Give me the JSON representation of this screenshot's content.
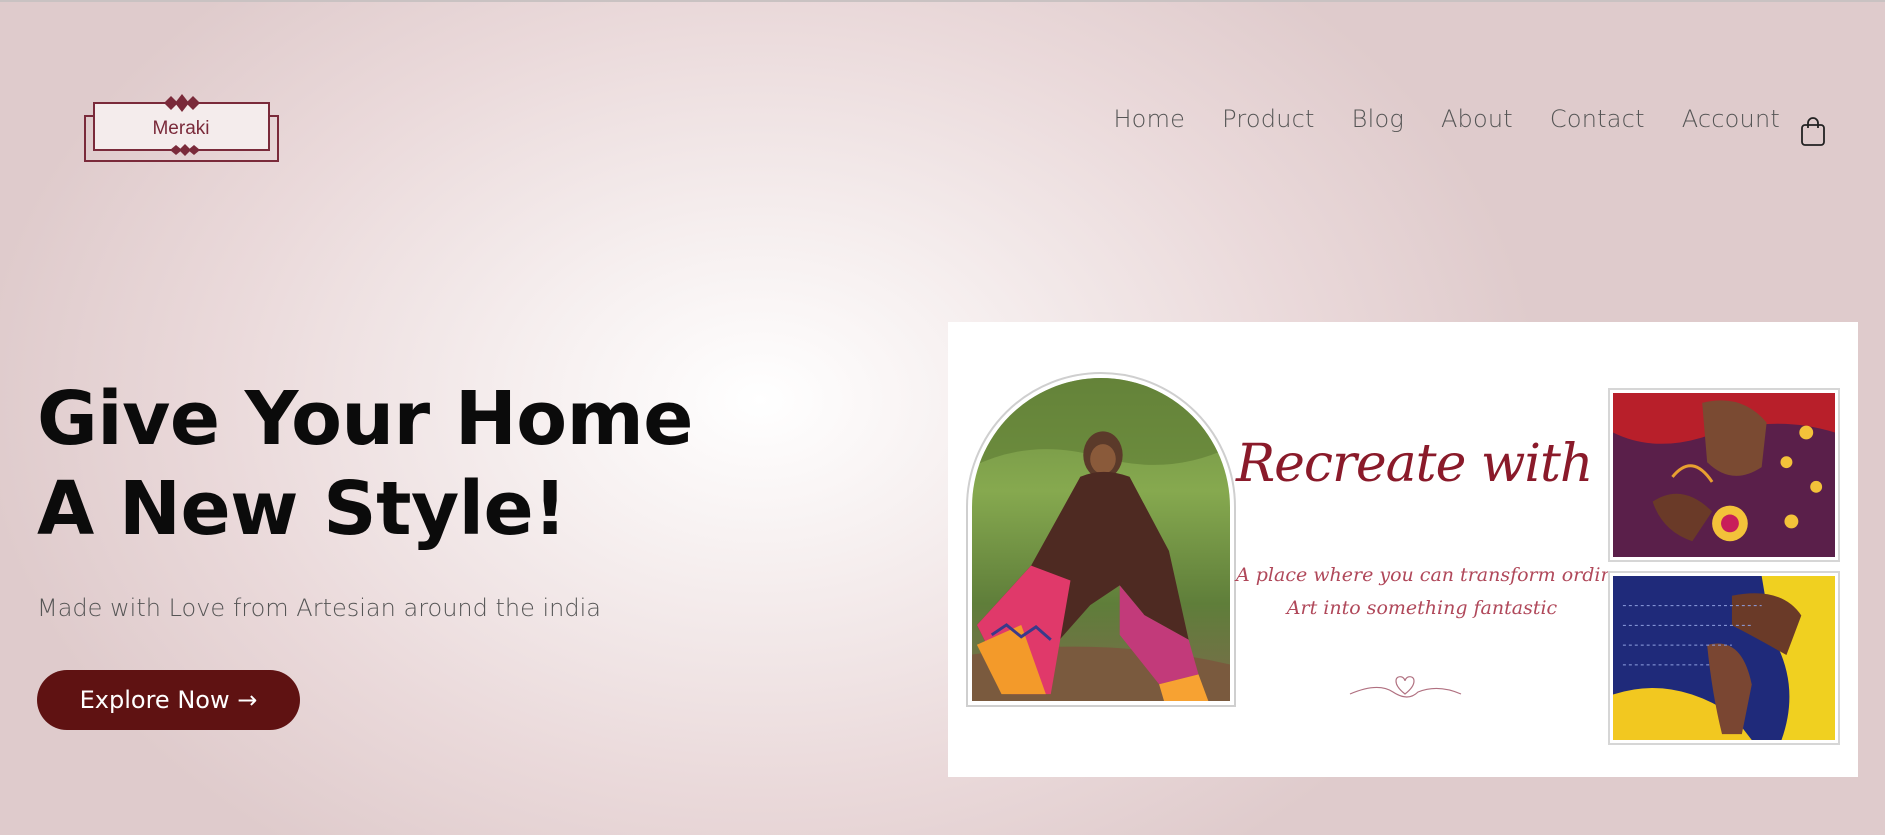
{
  "header": {
    "logo_text": "Meraki",
    "nav": [
      "Home",
      "Product",
      "Blog",
      "About",
      "Contact",
      "Account"
    ]
  },
  "hero": {
    "title_line1": "Give Your Home",
    "title_line2": "A New Style!",
    "subtitle": "Made with Love from Artesian around the india",
    "cta_label": "Explore Now →"
  },
  "banner": {
    "script_title": "Recreate with love",
    "tagline_line1": "A place where you can transform ordinary",
    "tagline_line2": "Art into something fantastic"
  },
  "colors": {
    "brand": "#5f1212",
    "logo": "#7a2a3a",
    "script": "#8a1a2a"
  },
  "icons": {
    "cart": "shopping-bag-icon",
    "heart": "heart-swirl-icon"
  }
}
